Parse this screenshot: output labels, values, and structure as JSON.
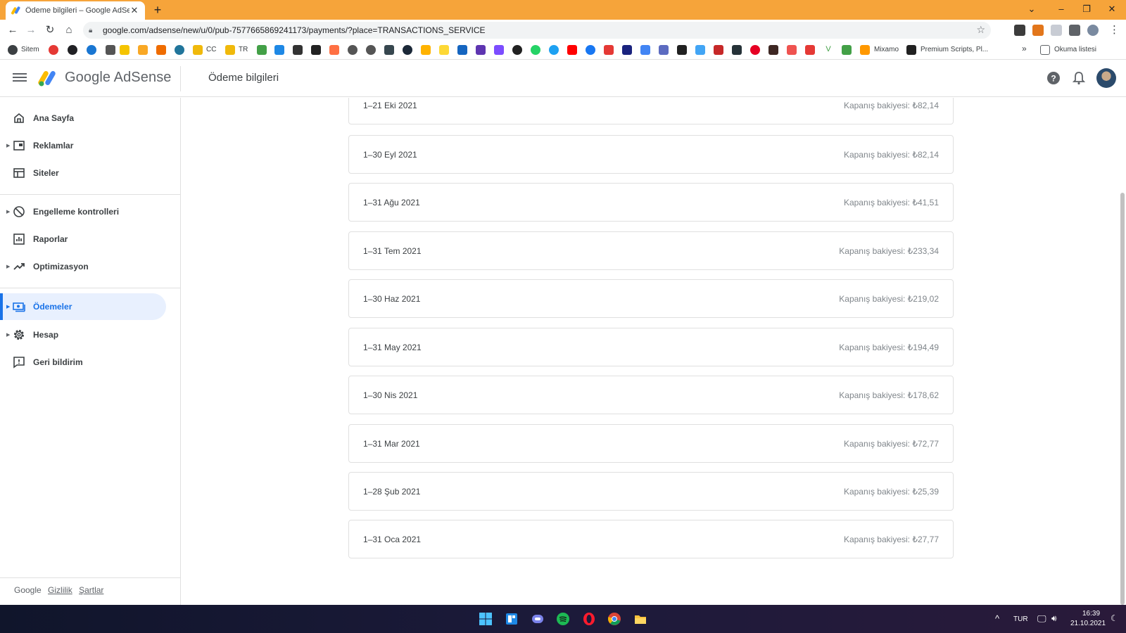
{
  "browser": {
    "tab_title": "Ödeme bilgileri – Google AdSense",
    "url": "google.com/adsense/new/u/0/pub-7577665869241173/payments/?place=TRANSACTIONS_SERVICE",
    "bookmarks": {
      "sitem": "Sitem",
      "cc": "CC",
      "tr": "TR",
      "mixamo": "Mixamo",
      "premium": "Premium Scripts, Pl...",
      "reading_list": "Okuma listesi"
    }
  },
  "header": {
    "brand": "Google AdSense",
    "page_title": "Ödeme bilgileri"
  },
  "sidebar": {
    "items": [
      {
        "label": "Ana Sayfa"
      },
      {
        "label": "Reklamlar"
      },
      {
        "label": "Siteler"
      },
      {
        "label": "Engelleme kontrolleri"
      },
      {
        "label": "Raporlar"
      },
      {
        "label": "Optimizasyon"
      },
      {
        "label": "Ödemeler"
      },
      {
        "label": "Hesap"
      },
      {
        "label": "Geri bildirim"
      }
    ],
    "footer": {
      "google": "Google",
      "privacy": "Gizlilik",
      "terms": "Şartlar"
    }
  },
  "transactions": [
    {
      "period": "1–21 Eki 2021",
      "balance": "Kapanış bakiyesi: ₺82,14"
    },
    {
      "period": "1–30 Eyl 2021",
      "balance": "Kapanış bakiyesi: ₺82,14"
    },
    {
      "period": "1–31 Ağu 2021",
      "balance": "Kapanış bakiyesi: ₺41,51"
    },
    {
      "period": "1–31 Tem 2021",
      "balance": "Kapanış bakiyesi: ₺233,34"
    },
    {
      "period": "1–30 Haz 2021",
      "balance": "Kapanış bakiyesi: ₺219,02"
    },
    {
      "period": "1–31 May 2021",
      "balance": "Kapanış bakiyesi: ₺194,49"
    },
    {
      "period": "1–30 Nis 2021",
      "balance": "Kapanış bakiyesi: ₺178,62"
    },
    {
      "period": "1–31 Mar 2021",
      "balance": "Kapanış bakiyesi: ₺72,77"
    },
    {
      "period": "1–28 Şub 2021",
      "balance": "Kapanış bakiyesi: ₺25,39"
    },
    {
      "period": "1–31 Oca 2021",
      "balance": "Kapanış bakiyesi: ₺27,77"
    }
  ],
  "taskbar": {
    "language": "TUR",
    "time": "16:39",
    "date": "21.10.2021"
  }
}
